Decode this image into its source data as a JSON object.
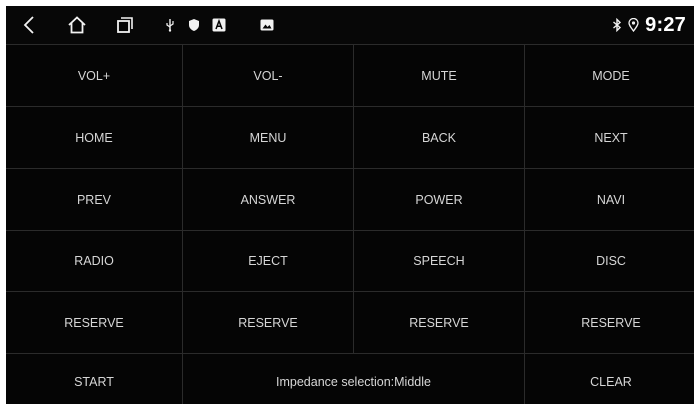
{
  "status_bar": {
    "clock": "9:27"
  },
  "keys": {
    "vol_up": "VOL+",
    "vol_down": "VOL-",
    "mute": "MUTE",
    "mode": "MODE",
    "home": "HOME",
    "menu": "MENU",
    "back": "BACK",
    "next": "NEXT",
    "prev": "PREV",
    "answer": "ANSWER",
    "power": "POWER",
    "navi": "NAVI",
    "radio": "RADIO",
    "eject": "EJECT",
    "speech": "SPEECH",
    "disc": "DISC",
    "reserve_1": "RESERVE",
    "reserve_2": "RESERVE",
    "reserve_3": "RESERVE",
    "reserve_4": "RESERVE",
    "start": "START",
    "impedance": "Impedance selection:Middle",
    "clear": "CLEAR"
  },
  "colors": {
    "background": "#050505",
    "grid_lines": "#2b2b2b",
    "label_text": "#d6d6d6",
    "status_icons": "#f2f2f2"
  },
  "icons": {
    "nav": [
      "back-arrow-icon",
      "home-icon",
      "recent-apps-icon"
    ],
    "notifications": [
      "usb-icon",
      "shield-icon",
      "font-a-icon",
      "image-icon"
    ],
    "status": [
      "bluetooth-icon",
      "location-pin-icon"
    ]
  }
}
